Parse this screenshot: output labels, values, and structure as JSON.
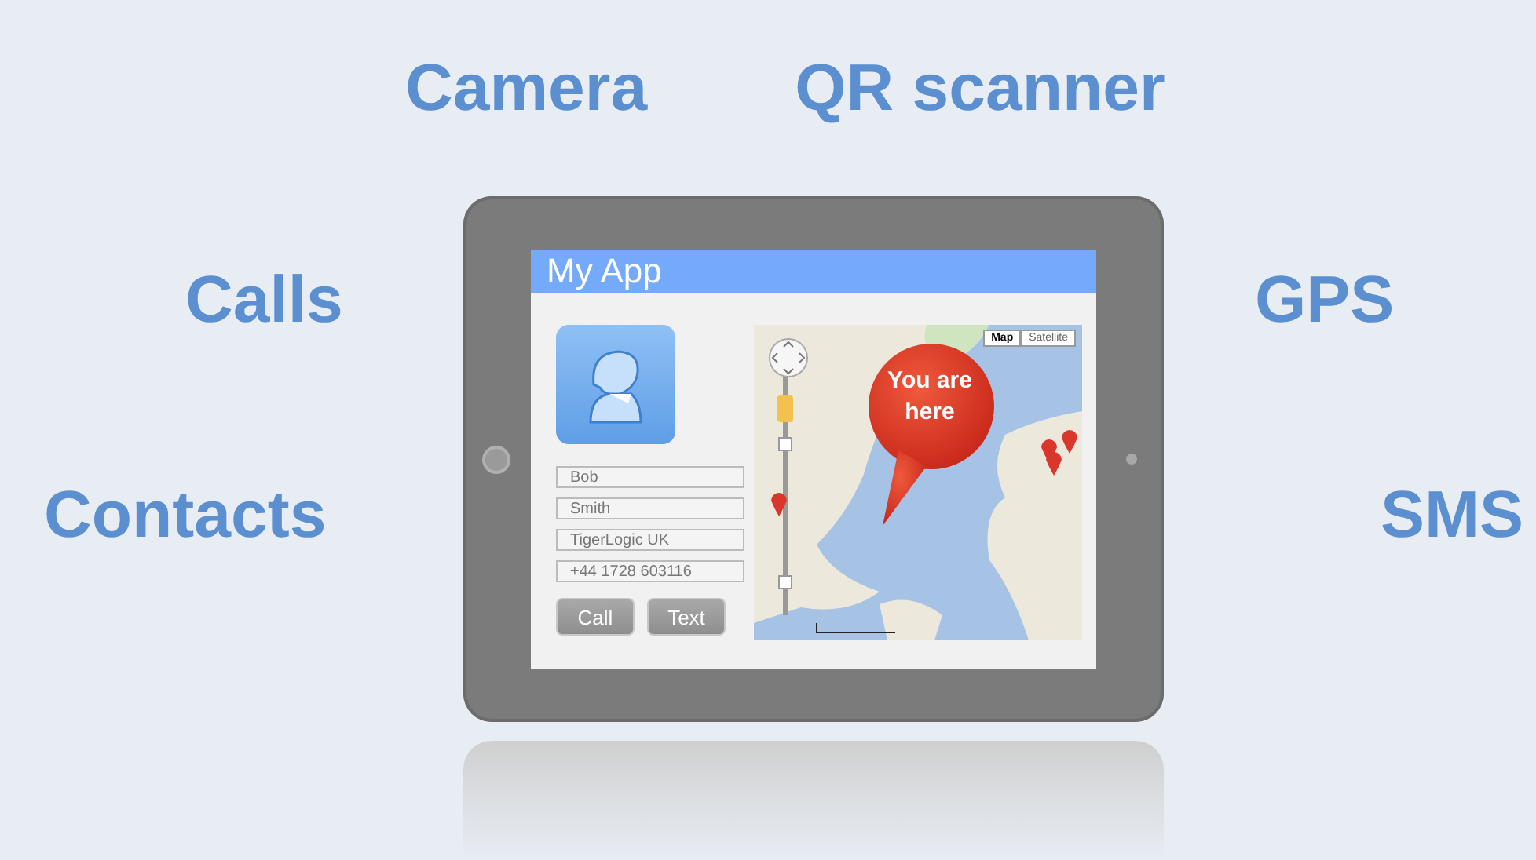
{
  "features_top": [
    "Camera",
    "QR scanner"
  ],
  "features_left": [
    "Calls",
    "Contacts"
  ],
  "features_right": [
    "GPS",
    "SMS"
  ],
  "app": {
    "title": "My App",
    "contact_fields": [
      {
        "value": "Bob"
      },
      {
        "value": "Smith"
      },
      {
        "value": "TigerLogic UK"
      },
      {
        "value": "+44 1728 603116"
      }
    ],
    "buttons": [
      {
        "label": "Call"
      },
      {
        "label": "Text"
      }
    ],
    "map": {
      "type_buttons": [
        {
          "label": "Map",
          "selected": true
        },
        {
          "label": "Satellite",
          "selected": false
        }
      ],
      "callout": "You are here"
    }
  }
}
